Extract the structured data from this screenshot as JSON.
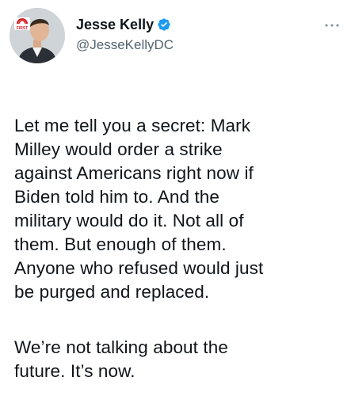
{
  "author": {
    "display_name": "Jesse Kelly",
    "handle": "@JesseKellyDC",
    "verified": true,
    "avatar_badge_text": "FIRST"
  },
  "tweet": {
    "paragraphs": [
      "Let me tell you a secret: Mark\nMilley would order a strike\nagainst Americans right now if\nBiden told him to. And the\nmilitary would do it. Not all of\nthem. But enough of them.\nAnyone who refused would just\nbe purged and replaced.",
      "We’re not talking about the\nfuture. It’s now."
    ]
  },
  "icons": {
    "verified": "verified-badge-icon",
    "more": "more-options-icon"
  },
  "colors": {
    "verified_blue": "#1d9bf0",
    "text": "#0f1419",
    "secondary_text": "#536471",
    "badge_red": "#d32027"
  }
}
